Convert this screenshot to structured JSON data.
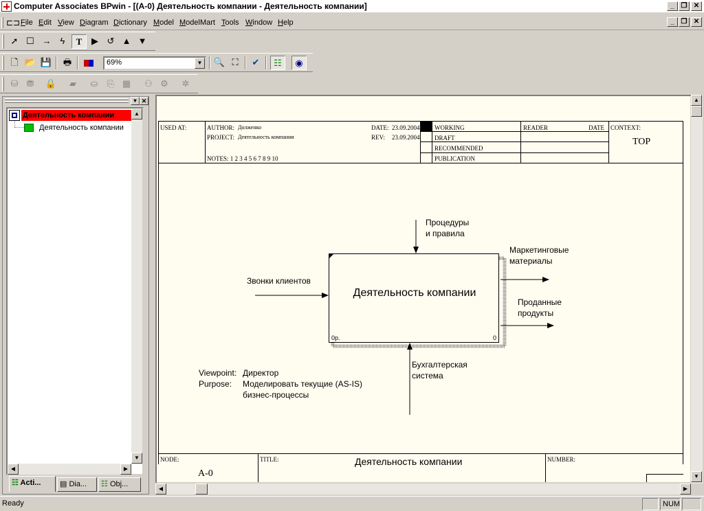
{
  "window": {
    "title": "Computer Associates BPwin - [(A-0) Деятельность компании - Деятельность компании]"
  },
  "menu": [
    "File",
    "Edit",
    "View",
    "Diagram",
    "Dictionary",
    "Model",
    "ModelMart",
    "Tools",
    "Window",
    "Help"
  ],
  "toolbar": {
    "zoom_value": "69%"
  },
  "tree": {
    "root": "Деятельность компании",
    "child": "Деятельность компании"
  },
  "tabs": [
    "Acti...",
    "Dia...",
    "Obj..."
  ],
  "diagram": {
    "header": {
      "used_at": "USED AT:",
      "author_label": "AUTHOR:",
      "author": "Долженко",
      "project_label": "PROJECT:",
      "project": "Деятельность компании",
      "date_label": "DATE:",
      "date": "23.09.2004",
      "rev_label": "REV:",
      "rev": "23.09.2004",
      "notes": "NOTES: 1 2 3 4 5 6 7 8 9 10",
      "working": "WORKING",
      "draft": "DRAFT",
      "recommended": "RECOMMENDED",
      "publication": "PUBLICATION",
      "reader": "READER",
      "reader_date": "DATE",
      "context": "CONTEXT:",
      "context_value": "TOP"
    },
    "activity": {
      "name": "Деятельность компании",
      "cost": "0р.",
      "number": "0"
    },
    "arrows": {
      "input": "Звонки клиентов",
      "control_1": "Процедуры",
      "control_2": "и правила",
      "output1_1": "Маркетинговые",
      "output1_2": "материалы",
      "output2_1": "Проданные",
      "output2_2": "продукты",
      "mechanism_1": "Бухгалтерская",
      "mechanism_2": "система"
    },
    "purpose": {
      "viewpoint_label": "Viewpoint:",
      "viewpoint": "Директор",
      "purpose_label": "Purpose:",
      "purpose_1": "Моделировать текущие (AS-IS)",
      "purpose_2": "бизнес-процессы"
    },
    "footer": {
      "node_label": "NODE:",
      "node": "A-0",
      "title_label": "TITLE:",
      "title": "Деятельность компании",
      "number_label": "NUMBER:"
    }
  },
  "status": {
    "text": "Ready",
    "num": "NUM"
  },
  "colors": {
    "canvas_bg": "#fffcf0",
    "tree_selected_bg": "#ff0000",
    "tree_icon": "#00c000"
  }
}
